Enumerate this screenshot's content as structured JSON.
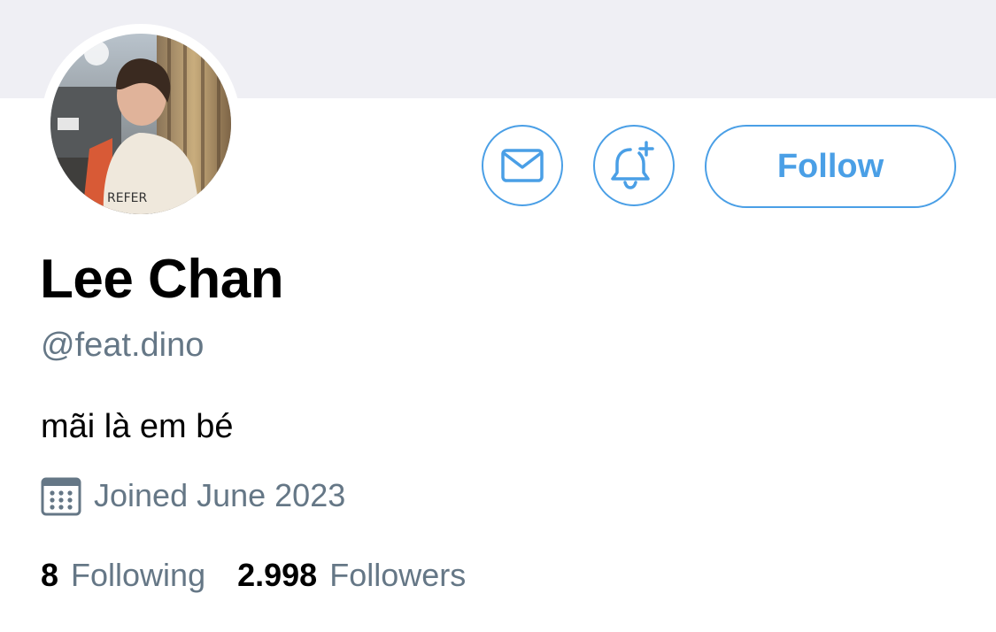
{
  "profile": {
    "display_name": "Lee Chan",
    "handle": "@feat.dino",
    "bio": "mãi là em bé",
    "joined": "Joined June 2023"
  },
  "actions": {
    "message_icon": "mail-icon",
    "notify_icon": "bell-plus-icon",
    "follow_label": "Follow"
  },
  "stats": {
    "following_count": "8",
    "following_label": "Following",
    "followers_count": "2.998",
    "followers_label": "Followers"
  },
  "colors": {
    "accent": "#4a9fe6",
    "secondary_text": "#657786",
    "banner": "#efeff4"
  }
}
